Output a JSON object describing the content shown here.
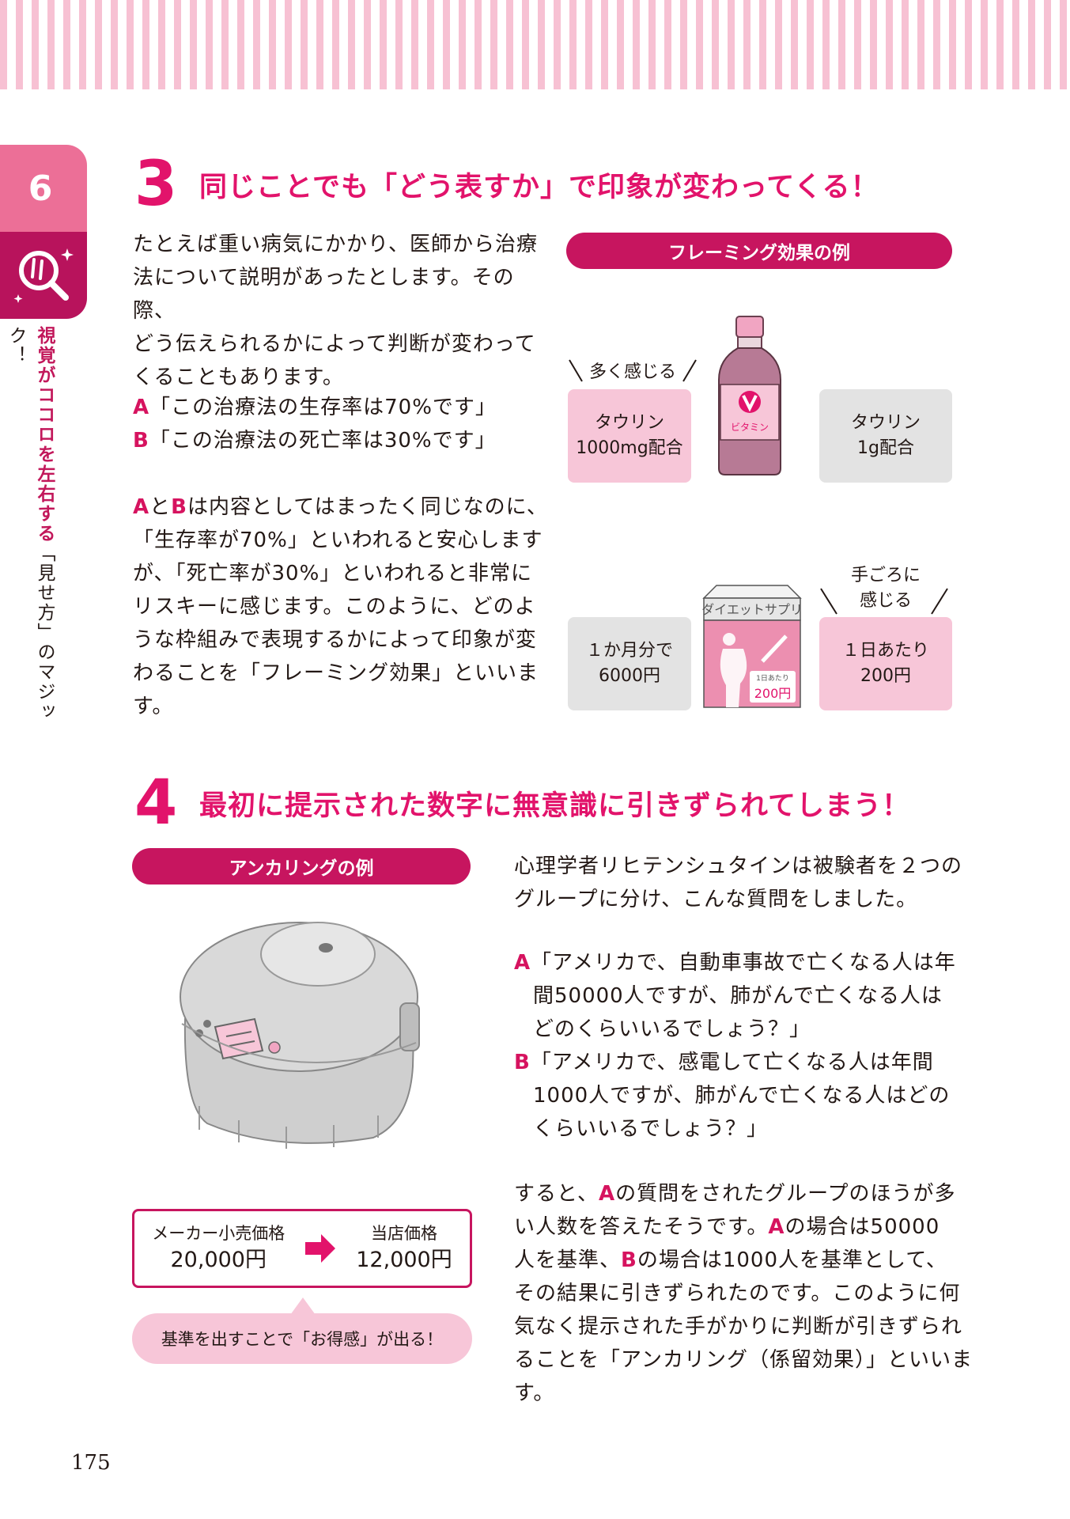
{
  "chapter": {
    "number": "6",
    "title_hl": "視覚がココロを左右する",
    "title_rest": "「見せ方」のマジック！"
  },
  "section3": {
    "number": "3",
    "title": "同じことでも「どう表すか」で印象が変わってくる！",
    "para1": [
      "たとえば重い病気にかかり、医師から治療",
      "法について説明があったとします。その際、",
      "どう伝えられるかによって判断が変わって",
      "くることもあります。"
    ],
    "quote_a_label": "A",
    "quote_a": "「この治療法の生存率は70%です」",
    "quote_b_label": "B",
    "quote_b": "「この治療法の死亡率は30%です」",
    "para2_a": "A",
    "para2_to": "と",
    "para2_b": "B",
    "para2_first": "は内容としてはまったく同じなのに、",
    "para2": [
      "「生存率が70%」といわれると安心します",
      "が、「死亡率が30%」といわれると非常に",
      "リスキーに感じます。このように、どのよ",
      "うな枠組みで表現するかによって印象が変",
      "わることを「フレーミング効果」といいます。"
    ],
    "figure": {
      "header": "フレーミング効果の例",
      "label_more": "多く感じる",
      "box1_line1": "タウリン",
      "box1_line2": "1000mg配合",
      "bottle_label": "ビタミン",
      "box2_line1": "タウリン",
      "box2_line2": "1g配合",
      "label_cheap_1": "手ごろに",
      "label_cheap_2": "感じる",
      "box3_line1": "１か月分で",
      "box3_line2": "6000円",
      "pack_title": "ダイエットサプリ",
      "pack_tag_small": "1日あたり",
      "pack_tag_price": "200円",
      "box4_line1": "１日あたり",
      "box4_line2": "200円"
    }
  },
  "section4": {
    "number": "4",
    "title": "最初に提示された数字に無意識に引きずられてしまう！",
    "figure_header": "アンカリングの例",
    "price_label_1": "メーカー小売価格",
    "price_value_1": "20,000円",
    "price_label_2": "当店価格",
    "price_value_2": "12,000円",
    "bubble": "基準を出すことで「お得感」が出る！",
    "para1": [
      "心理学者リヒテンシュタインは被験者を２つの",
      "グループに分け、こんな質問をしました。"
    ],
    "qa_label": "A",
    "qa": [
      "「アメリカで、自動車事故で亡くなる人は年",
      "間50000人ですが、肺がんで亡くなる人は",
      "どのくらいいるでしょう？」"
    ],
    "qb_label": "B",
    "qb": [
      "「アメリカで、感電して亡くなる人は年間",
      "1000人ですが、肺がんで亡くなる人はどの",
      "くらいいるでしょう？」"
    ],
    "para2_l1_pre": "すると、",
    "para2_l1_a": "A",
    "para2_l1_post": "の質問をされたグループのほうが多",
    "para2_l2_pre": "い人数を答えたそうです。",
    "para2_l2_a": "A",
    "para2_l2_post": "の場合は50000",
    "para2_l3_pre": "人を基準、",
    "para2_l3_b": "B",
    "para2_l3_post": "の場合は1000人を基準として、",
    "para2_rest": [
      "その結果に引きずられたのです。このように何",
      "気なく提示された手がかりに判断が引きずられ",
      "ることを「アンカリング（係留効果）」といいます。"
    ]
  },
  "page_number": "175"
}
